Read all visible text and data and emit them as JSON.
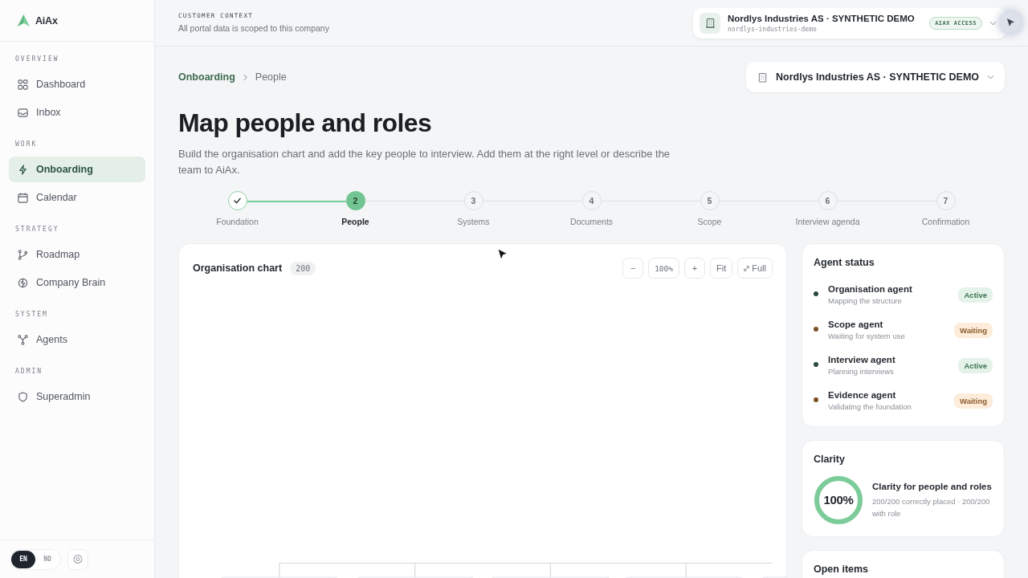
{
  "sidebar": {
    "logo": {
      "text": "AiAx"
    },
    "sections": [
      {
        "title": "OVERVIEW",
        "items": [
          {
            "label": "Dashboard",
            "selected": false
          },
          {
            "label": "Inbox",
            "selected": false
          }
        ]
      },
      {
        "title": "WORK",
        "items": [
          {
            "label": "Onboarding",
            "selected": true
          },
          {
            "label": "Calendar",
            "selected": false
          }
        ]
      },
      {
        "title": "STRATEGY",
        "items": [
          {
            "label": "Roadmap",
            "selected": false
          },
          {
            "label": "Company Brain",
            "selected": false
          }
        ]
      },
      {
        "title": "SYSTEM",
        "items": [
          {
            "label": "Agents",
            "selected": false
          }
        ]
      },
      {
        "title": "ADMIN",
        "items": [
          {
            "label": "Superadmin",
            "selected": false
          }
        ]
      }
    ],
    "languages": [
      {
        "label": "EN",
        "selected": true
      },
      {
        "label": "NO",
        "selected": false
      }
    ]
  },
  "topbar": {
    "eyebrow": "CUSTOMER CONTEXT",
    "note": "All portal data is scoped to this company",
    "company": {
      "name": "Nordlys Industries AS · SYNTHETIC DEMO",
      "slug": "nordlys-industries-demo",
      "badge": "AIAX ACCESS"
    }
  },
  "breadcrumb": [
    {
      "label": "Onboarding",
      "kind": "link"
    },
    {
      "label": "People",
      "kind": "current"
    }
  ],
  "company_select": {
    "value": "Nordlys Industries AS · SYNTHETIC DEMO"
  },
  "page": {
    "title": "Map people and roles",
    "description": "Build the organisation chart and add the key people to interview. Add them at the right level or describe the team to AiAx."
  },
  "steps": [
    {
      "label": "Foundation",
      "done": true,
      "selected": false
    },
    {
      "number": "2",
      "label": "People",
      "done": false,
      "selected": true
    },
    {
      "number": "3",
      "label": "Systems",
      "done": false,
      "selected": false
    },
    {
      "number": "4",
      "label": "Documents",
      "done": false,
      "selected": false
    },
    {
      "number": "5",
      "label": "Scope",
      "done": false,
      "selected": false
    },
    {
      "number": "6",
      "label": "Interview agenda",
      "done": false,
      "selected": false
    },
    {
      "number": "7",
      "label": "Confirmation",
      "done": false,
      "selected": false
    }
  ],
  "org_chart": {
    "title": "Organisation chart",
    "count": "200",
    "controls": [
      {
        "label": "−",
        "kind": "zoom-out"
      },
      {
        "label": "100%",
        "kind": "zoom-level"
      },
      {
        "label": "+",
        "kind": "zoom-in"
      },
      {
        "label": "Fit",
        "kind": "fit"
      },
      {
        "label": "Full",
        "kind": "fullscreen"
      }
    ]
  },
  "agent_status": {
    "title": "Agent status",
    "agents": [
      {
        "name": "Organisation agent",
        "activity": "Mapping the structure",
        "color": "#2c4a3b",
        "kind": "active",
        "badge": "Active"
      },
      {
        "name": "Scope agent",
        "activity": "Waiting for system use",
        "color": "#7b5128",
        "kind": "waiting",
        "badge": "Waiting"
      },
      {
        "name": "Interview agent",
        "activity": "Planning interviews",
        "color": "#2c4a3b",
        "kind": "active",
        "badge": "Active"
      },
      {
        "name": "Evidence agent",
        "activity": "Validating the foundation",
        "color": "#7b5128",
        "kind": "waiting",
        "badge": "Waiting"
      }
    ]
  },
  "clarity": {
    "title": "Clarity",
    "level": 1,
    "reading": "100%",
    "heading": "Clarity for people and roles",
    "detail": "200/200 correctly placed · 200/200 with role"
  },
  "open_items": {
    "title": "Open items"
  }
}
